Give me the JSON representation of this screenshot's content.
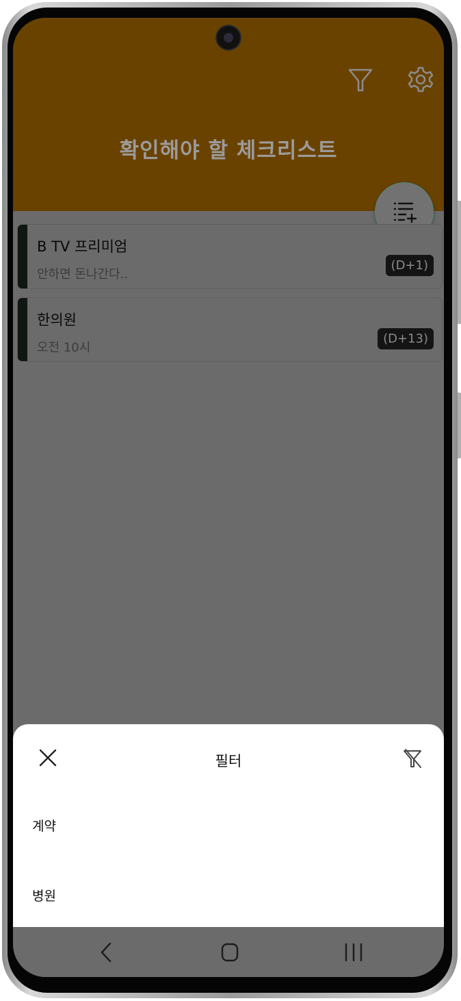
{
  "header": {
    "title": "확인해야 할 체크리스트",
    "filter_icon": "filter-icon",
    "settings_icon": "gear-icon",
    "color": "#6a4200"
  },
  "fab": {
    "icon": "add-list-icon"
  },
  "items": [
    {
      "title": "B TV 프리미엄",
      "subtitle": "안하면 돈나간다..",
      "badge": "(D+1)"
    },
    {
      "title": "한의원",
      "subtitle": "오전 10시",
      "badge": "(D+13)"
    }
  ],
  "filter_sheet": {
    "title": "필터",
    "close_icon": "close-icon",
    "clear_filter_icon": "filter-off-icon",
    "options": [
      {
        "label": "계약"
      },
      {
        "label": "병원"
      }
    ]
  },
  "navigation": {
    "back_icon": "back-icon",
    "home_icon": "home-icon",
    "recents_icon": "recents-icon"
  }
}
